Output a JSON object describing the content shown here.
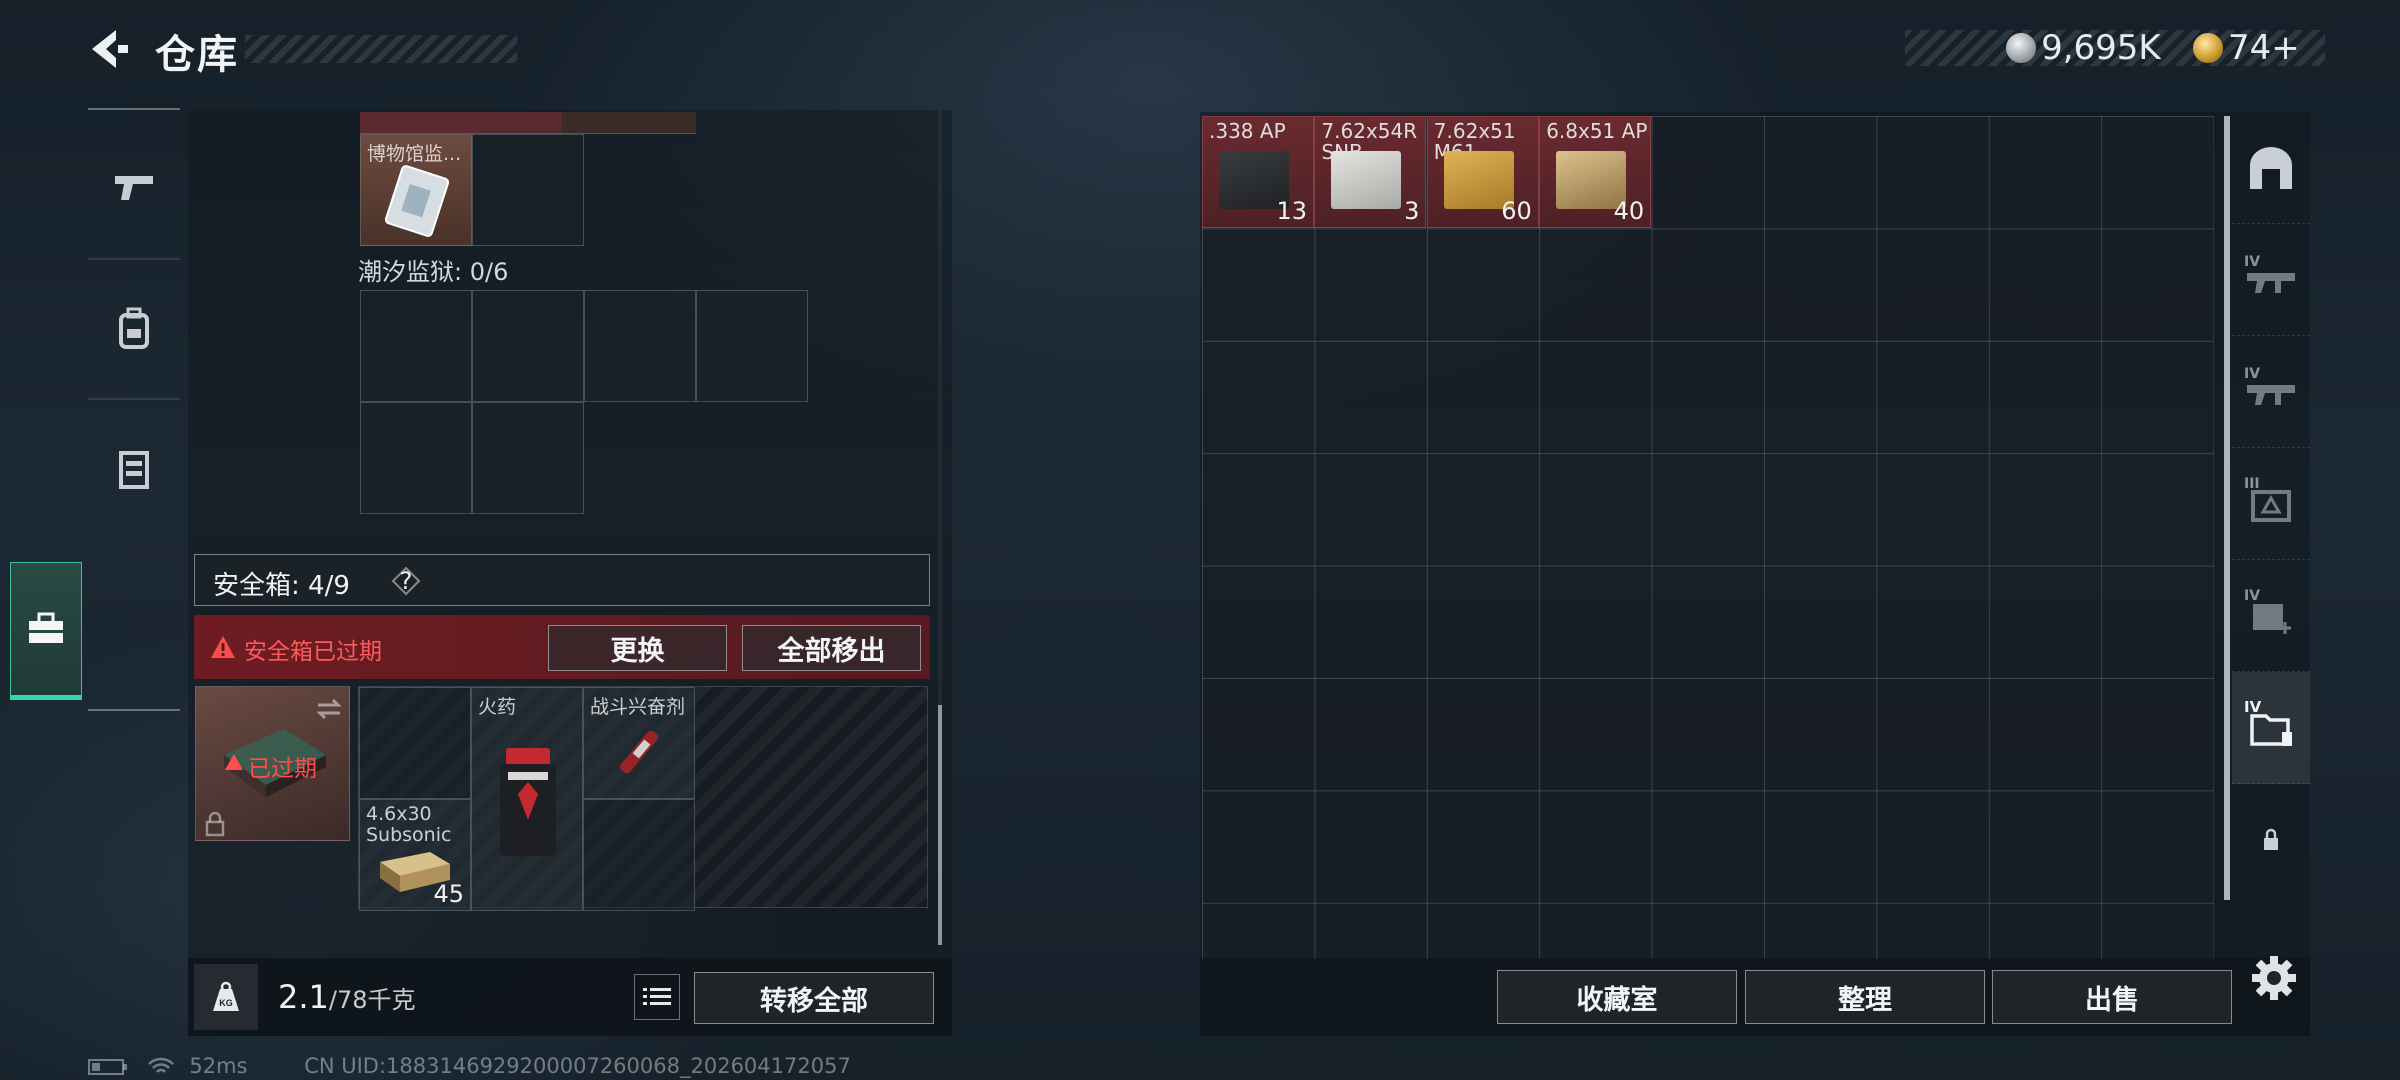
{
  "header": {
    "title": "仓库",
    "currency": [
      {
        "icon": "silver-coin-icon",
        "value": "9,695K"
      },
      {
        "icon": "gold-coin-icon",
        "value": "74+"
      }
    ]
  },
  "side_nav": {
    "items": [
      {
        "icon": "pistol-icon"
      },
      {
        "icon": "backpack-icon"
      },
      {
        "icon": "chest-rig-icon"
      },
      {
        "icon": "toolbox-icon",
        "active": true
      }
    ]
  },
  "left": {
    "museum_item": {
      "name": "博物馆监..."
    },
    "tide_prison": {
      "label": "潮汐监狱:",
      "count": "0/6"
    },
    "safe": {
      "label": "安全箱:",
      "count": "4/9",
      "help": "?",
      "warning": "安全箱已过期",
      "swap_label": "更换",
      "move_all_label": "全部移出",
      "case_status": "已过期"
    },
    "safe_items": [
      {
        "name": "火药"
      },
      {
        "name": "战斗兴奋剂"
      },
      {
        "name": "4.6x30 Subsonic",
        "count": "45"
      }
    ],
    "weight": {
      "current": "2.1",
      "capacity": "/78千克"
    },
    "transfer_all_label": "转移全部"
  },
  "stash": {
    "items": [
      {
        "name": ".338 AP",
        "count": "13",
        "color": "#2a2d2f"
      },
      {
        "name": "7.62x54R SNB",
        "count": "3",
        "color": "#cfd0cc"
      },
      {
        "name": "7.62x51 M61",
        "count": "60",
        "color": "#c99a3a"
      },
      {
        "name": "6.8x51 AP",
        "count": "40",
        "color": "#c9a86a"
      }
    ]
  },
  "right_tabs": [
    {
      "icon": "vault-icon"
    },
    {
      "icon": "rifle-tier-iv-icon",
      "tier": "IV"
    },
    {
      "icon": "rifle-tier-iv-icon",
      "tier": "IV"
    },
    {
      "icon": "ammo-crate-tier-iii-icon",
      "tier": "III"
    },
    {
      "icon": "medical-tier-iv-icon",
      "tier": "IV"
    },
    {
      "icon": "folder-tier-iv-icon",
      "tier": "IV",
      "active": true
    },
    {
      "icon": "lock-icon"
    }
  ],
  "bottom_right": {
    "collection_label": "收藏室",
    "sort_label": "整理",
    "sell_label": "出售"
  },
  "status": {
    "ping": "52ms",
    "uid": "CN UID:1883146929200007260068_202604172057"
  }
}
